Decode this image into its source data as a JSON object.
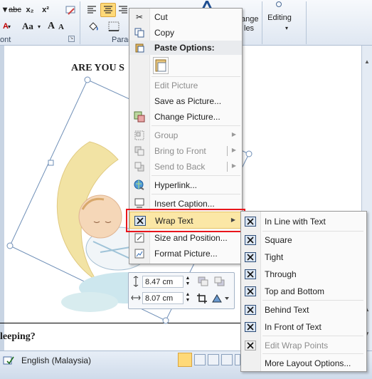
{
  "ribbon": {
    "font_buttons": [
      "abc",
      "x₂",
      "x²"
    ],
    "font_color_letter": "A",
    "change_case_label": "Aa",
    "grow_font_label": "A",
    "shrink_font_label": "A",
    "font_group_label": "ont",
    "paragraph_group_label": "Parag",
    "styles_label_partial": "ange",
    "styles_label_partial2": "les",
    "editing_label": "Editing"
  },
  "document": {
    "heading": "ARE YOU S",
    "question": "leeping?"
  },
  "layout_toolbar": {
    "height_value": "8.47 cm",
    "width_value": "8.07 cm"
  },
  "status_bar": {
    "language": "English (Malaysia)"
  },
  "context_menu": {
    "items": [
      {
        "label": "Cut",
        "enabled": true
      },
      {
        "label": "Copy",
        "enabled": true
      },
      {
        "label": "Paste Options:",
        "enabled": true,
        "header": true
      },
      {
        "label": "Edit Picture",
        "enabled": false
      },
      {
        "label": "Save as Picture...",
        "enabled": true
      },
      {
        "label": "Change Picture...",
        "enabled": true
      },
      {
        "label": "Group",
        "enabled": false,
        "submenu": true
      },
      {
        "label": "Bring to Front",
        "enabled": false,
        "submenu": true
      },
      {
        "label": "Send to Back",
        "enabled": false,
        "submenu": true
      },
      {
        "label": "Hyperlink...",
        "enabled": true
      },
      {
        "label": "Insert Caption...",
        "enabled": true
      },
      {
        "label": "Wrap Text",
        "enabled": true,
        "submenu": true,
        "highlighted": true
      },
      {
        "label": "Size and Position...",
        "enabled": true
      },
      {
        "label": "Format Picture...",
        "enabled": true
      }
    ]
  },
  "wrap_text_submenu": {
    "items": [
      {
        "label": "In Line with Text",
        "enabled": true
      },
      {
        "label": "Square",
        "enabled": true
      },
      {
        "label": "Tight",
        "enabled": true
      },
      {
        "label": "Through",
        "enabled": true
      },
      {
        "label": "Top and Bottom",
        "enabled": true
      },
      {
        "label": "Behind Text",
        "enabled": true
      },
      {
        "label": "In Front of Text",
        "enabled": true
      },
      {
        "label": "Edit Wrap Points",
        "enabled": false
      },
      {
        "label": "More Layout Options...",
        "enabled": true
      }
    ]
  },
  "colors": {
    "highlight_border": "#e8151b",
    "menu_hover": "#fbe7a6",
    "selection_handle": "#6f8fb7"
  }
}
